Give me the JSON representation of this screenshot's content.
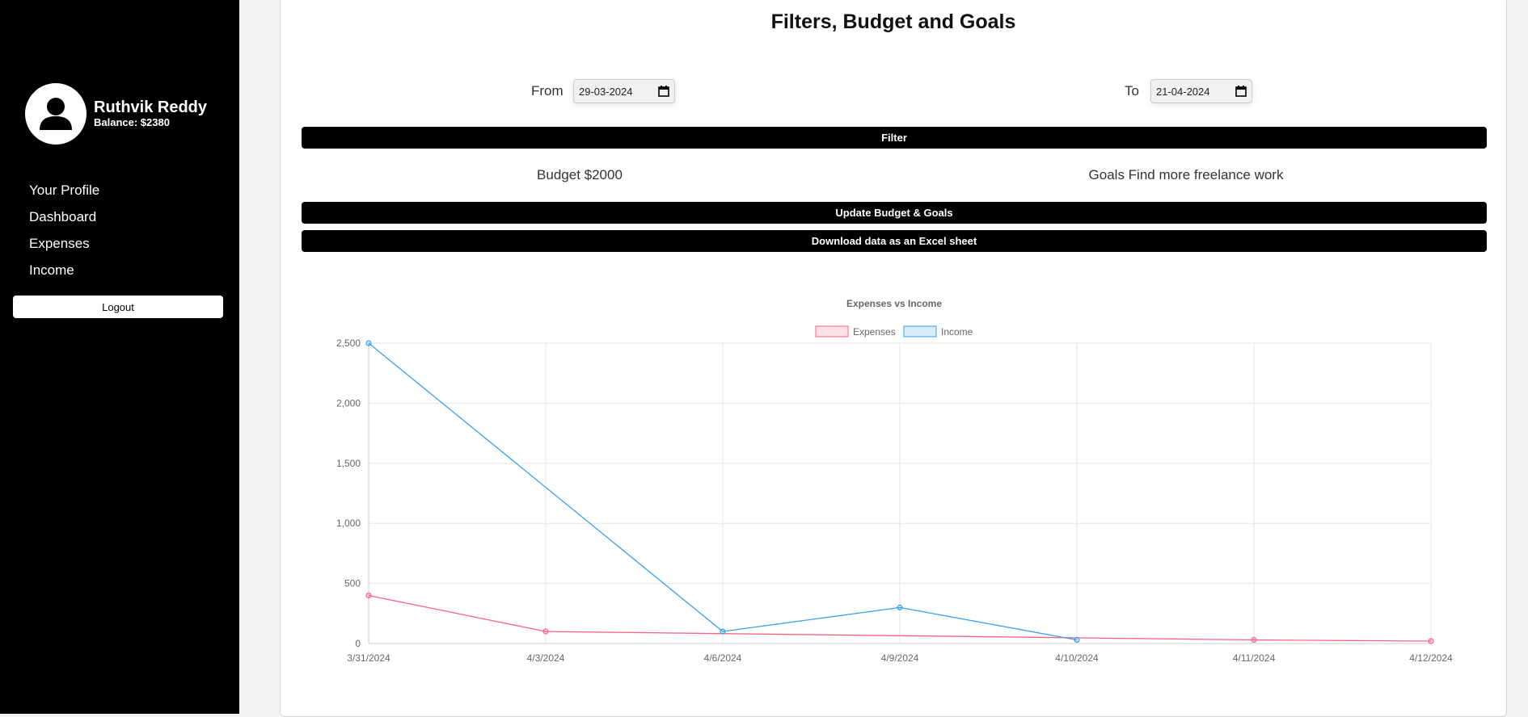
{
  "sidebar": {
    "user": {
      "name": "Ruthvik Reddy",
      "balance": "Balance: $2380"
    },
    "nav": [
      {
        "label": "Your Profile"
      },
      {
        "label": "Dashboard"
      },
      {
        "label": "Expenses"
      },
      {
        "label": "Income"
      }
    ],
    "logout_label": "Logout"
  },
  "main": {
    "title": "Filters, Budget and Goals",
    "filters": {
      "from_label": "From",
      "from_value": "29-03-2024",
      "to_label": "To",
      "to_value": "21-04-2024",
      "filter_button": "Filter"
    },
    "budget_text": "Budget $2000",
    "goals_text": "Goals Find more freelance work",
    "update_button": "Update Budget & Goals",
    "download_button": "Download data as an Excel sheet"
  },
  "colors": {
    "expenses": "#ff6384",
    "income": "#36a2eb"
  },
  "chart_data": {
    "type": "line",
    "title": "Expenses vs Income",
    "categories": [
      "3/31/2024",
      "4/3/2024",
      "4/6/2024",
      "4/9/2024",
      "4/10/2024",
      "4/11/2024",
      "4/12/2024"
    ],
    "series": [
      {
        "name": "Expenses",
        "values": [
          400,
          100,
          null,
          null,
          null,
          30,
          20
        ]
      },
      {
        "name": "Income",
        "values": [
          2500,
          null,
          100,
          300,
          30,
          null,
          null
        ]
      }
    ],
    "ylim": [
      0,
      2500
    ],
    "yticks": [
      "0",
      "500",
      "1,000",
      "1,500",
      "2,000",
      "2,500"
    ],
    "legend": "top-center",
    "grid": true
  }
}
